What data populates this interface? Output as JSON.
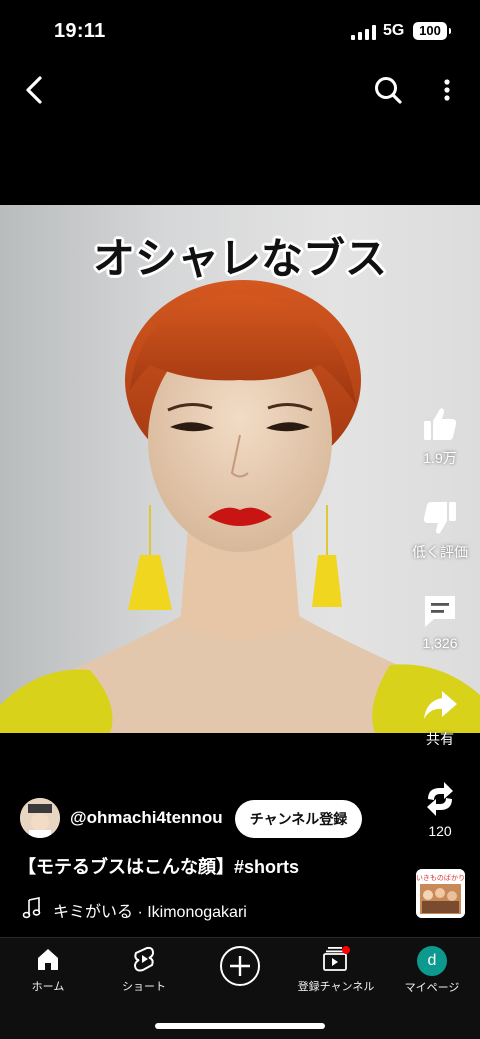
{
  "status_bar": {
    "time": "19:11",
    "network": "5G",
    "battery": "100"
  },
  "video": {
    "caption": "オシャレなブス"
  },
  "actions": {
    "like_count": "1.9万",
    "dislike_label": "低く評価",
    "comment_count": "1,326",
    "share_label": "共有",
    "remix_count": "120"
  },
  "channel": {
    "handle": "@ohmachi4tennou",
    "subscribe_label": "チャンネル登録"
  },
  "short": {
    "title": "【モテるブスはこんな顔】#shorts"
  },
  "music": {
    "text": "キミがいる · Ikimonogakari",
    "album_text": "いきものばかり"
  },
  "nav": {
    "items": [
      {
        "label": "ホーム",
        "icon": "home-icon"
      },
      {
        "label": "ショート",
        "icon": "shorts-icon"
      },
      {
        "label": "",
        "icon": "create-icon"
      },
      {
        "label": "登録チャンネル",
        "icon": "subscriptions-icon"
      },
      {
        "label": "マイページ",
        "icon": "avatar"
      }
    ],
    "avatar_letter": "d"
  },
  "colors": {
    "accent_red": "#ff0000",
    "avatar_teal": "#0b9a8d",
    "lipstick": "#c91414",
    "hair": "#c0461a",
    "dress": "#d8d21a"
  }
}
